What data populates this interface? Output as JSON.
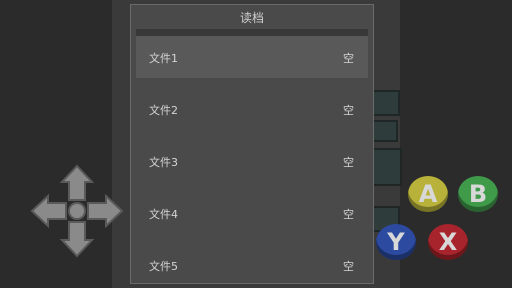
{
  "dialog": {
    "title": "读档",
    "slots": [
      {
        "name": "文件1",
        "status": "空"
      },
      {
        "name": "文件2",
        "status": "空"
      },
      {
        "name": "文件3",
        "status": "空"
      },
      {
        "name": "文件4",
        "status": "空"
      },
      {
        "name": "文件5",
        "status": "空"
      }
    ]
  },
  "controls": {
    "buttons": [
      {
        "label": "A",
        "color": "#b8b23a"
      },
      {
        "label": "B",
        "color": "#3f9a4a"
      },
      {
        "label": "Y",
        "color": "#2c4aa0"
      },
      {
        "label": "X",
        "color": "#a8242c"
      }
    ],
    "dpad_color": "#8a8a8a"
  }
}
